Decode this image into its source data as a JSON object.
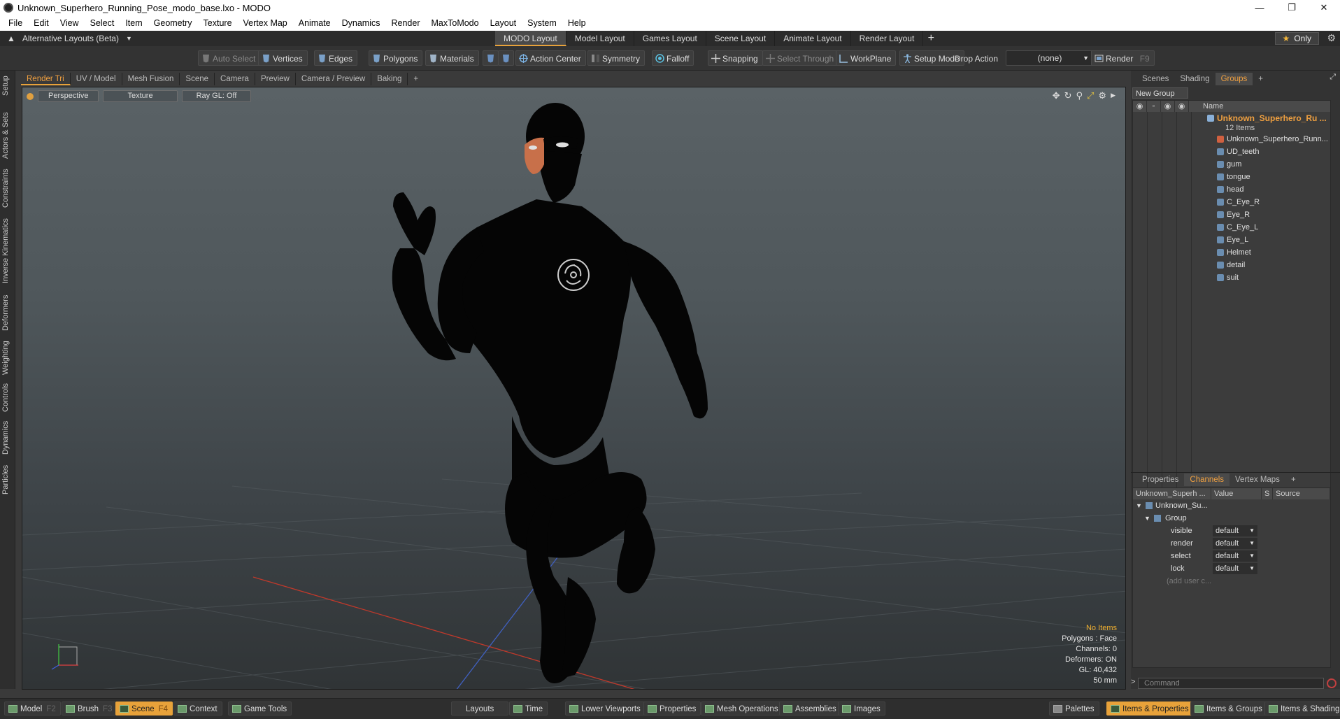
{
  "window": {
    "title": "Unknown_Superhero_Running_Pose_modo_base.lxo - MODO",
    "controls": [
      "minimize",
      "maximize",
      "close"
    ]
  },
  "menu": [
    "File",
    "Edit",
    "View",
    "Select",
    "Item",
    "Geometry",
    "Texture",
    "Vertex Map",
    "Animate",
    "Dynamics",
    "Render",
    "MaxToModo",
    "Layout",
    "System",
    "Help"
  ],
  "layoutbar": {
    "alt_layouts": "Alternative Layouts (Beta)",
    "tabs": [
      "MODO Layout",
      "Model Layout",
      "Games Layout",
      "Scene Layout",
      "Animate Layout",
      "Render Layout"
    ],
    "active_tab": "MODO Layout",
    "only": "Only"
  },
  "toolbar": {
    "auto_select": "Auto Select",
    "vertices": "Vertices",
    "edges": "Edges",
    "polygons": "Polygons",
    "materials": "Materials",
    "action_center": "Action Center",
    "symmetry": "Symmetry",
    "falloff": "Falloff",
    "snapping": "Snapping",
    "select_through": "Select Through",
    "workplane": "WorkPlane",
    "setup_mode": "Setup Mode",
    "drop_action": "Drop Action",
    "drop_value": "(none)",
    "render": "Render",
    "render_key": "F9"
  },
  "left_tabs": [
    "Setup",
    "Actors & Sets",
    "Constraints",
    "Inverse Kinematics",
    "Deformers",
    "Weighting",
    "Controls",
    "Dynamics",
    "Particles"
  ],
  "viewport": {
    "tabs": [
      "Render Tri",
      "UV / Model",
      "Mesh Fusion",
      "Scene",
      "Camera",
      "Preview",
      "Camera / Preview",
      "Baking"
    ],
    "active_tab": "Render Tri",
    "view_mode": "Perspective",
    "shading": "Texture",
    "raygl": "Ray GL: Off",
    "stats": {
      "items": "No Items",
      "polygons": "Polygons : Face",
      "channels": "Channels: 0",
      "deformers": "Deformers: ON",
      "gl": "GL: 40,432",
      "lens": "50 mm"
    }
  },
  "groups_panel": {
    "tabs": [
      "Scenes",
      "Shading",
      "Groups"
    ],
    "active_tab": "Groups",
    "new_group": "New Group",
    "name_header": "Name",
    "root_name": "Unknown_Superhero_Ru ...",
    "root_count": "12 Items",
    "items": [
      "Unknown_Superhero_Runn...",
      "UD_teeth",
      "gum",
      "tongue",
      "head",
      "C_Eye_R",
      "Eye_R",
      "C_Eye_L",
      "Eye_L",
      "Helmet",
      "detail",
      "suit"
    ]
  },
  "channels_panel": {
    "tabs": [
      "Properties",
      "Channels",
      "Vertex Maps"
    ],
    "active_tab": "Channels",
    "headers": [
      "Unknown_Superh ...",
      "Value",
      "S",
      "Source"
    ],
    "item": "Unknown_Su...",
    "group": "Group",
    "rows": [
      {
        "name": "visible",
        "value": "default"
      },
      {
        "name": "render",
        "value": "default"
      },
      {
        "name": "select",
        "value": "default"
      },
      {
        "name": "lock",
        "value": "default"
      }
    ],
    "add_user": "(add user c...",
    "command_placeholder": "Command"
  },
  "bottombar": {
    "left": [
      {
        "label": "Model",
        "key": "F2"
      },
      {
        "label": "Brush",
        "key": "F3"
      },
      {
        "label": "Scene",
        "key": "F4"
      },
      {
        "label": "Context",
        "key": ""
      },
      {
        "label": "Game Tools",
        "key": ""
      }
    ],
    "active": "Scene",
    "center": [
      "Layouts",
      "Time",
      "Lower Viewports",
      "Properties",
      "Mesh Operations",
      "Assemblies",
      "Images"
    ],
    "right": [
      "Palettes",
      "Items & Properties",
      "Items & Groups",
      "Items & Shading"
    ],
    "right_active": "Items & Properties"
  },
  "colors": {
    "accent": "#e8a23a",
    "axis_x": "#c0392b",
    "axis_z": "#4060c0"
  }
}
